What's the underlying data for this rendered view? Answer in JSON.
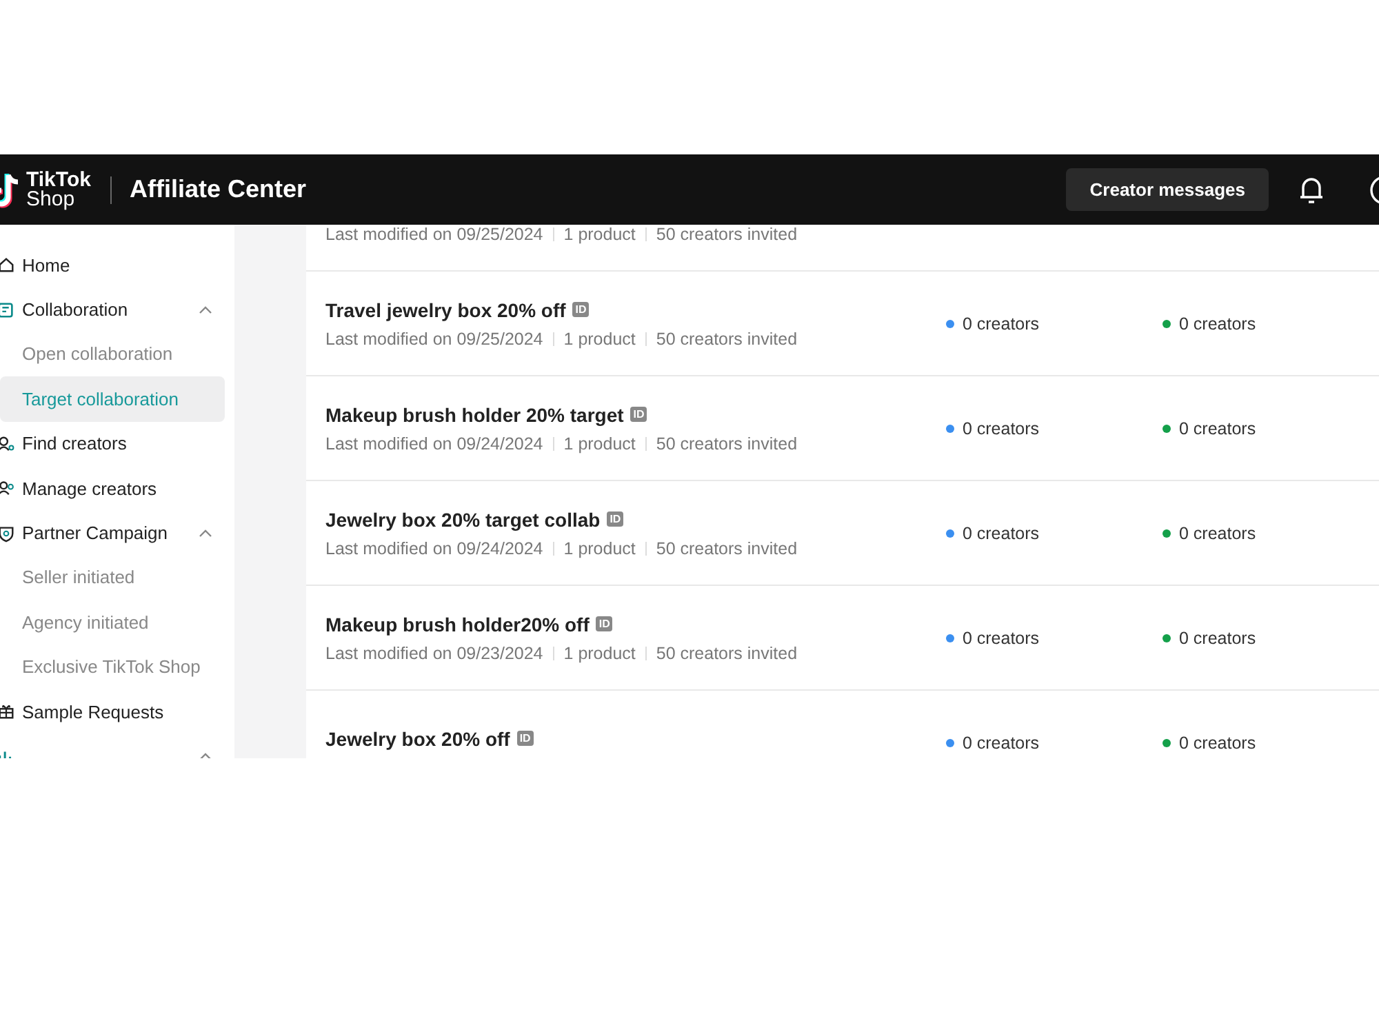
{
  "header": {
    "logo_line_1": "TikTok",
    "logo_line_2": "Shop",
    "title": "Affiliate Center",
    "button": "Creator messages"
  },
  "sidebar": {
    "items": [
      {
        "label": "Home",
        "selected": false
      },
      {
        "label": "Collaboration",
        "selected": false,
        "expanded": true,
        "children": [
          {
            "label": "Open collaboration",
            "selected": false
          },
          {
            "label": "Target collaboration",
            "selected": true
          }
        ]
      },
      {
        "label": "Find creators",
        "selected": false
      },
      {
        "label": "Manage creators",
        "selected": false
      },
      {
        "label": "Partner Campaign",
        "selected": false,
        "expanded": true,
        "children": [
          {
            "label": "Seller initiated",
            "selected": false
          },
          {
            "label": "Agency initiated",
            "selected": false
          },
          {
            "label": "Exclusive TikTok Shop",
            "selected": false
          }
        ]
      },
      {
        "label": "Sample Requests",
        "selected": false
      },
      {
        "selected": false,
        "expanded": true
      }
    ]
  },
  "rows": [
    {
      "meta": [
        "Last modified on 09/25/2024",
        "1 product",
        "50 creators invited"
      ]
    },
    {
      "title": "Travel jewelry box 20% off",
      "badge": "ID",
      "meta": [
        "Last modified on 09/25/2024",
        "1 product",
        "50 creators invited"
      ],
      "status": [
        {
          "text": "0 creators",
          "color": "#3b8ff0"
        },
        {
          "text": "0 creators",
          "color": "#14a04a"
        }
      ]
    },
    {
      "title": "Makeup brush holder 20% target",
      "badge": "ID",
      "meta": [
        "Last modified on 09/24/2024",
        "1 product",
        "50 creators invited"
      ],
      "status": [
        {
          "text": "0 creators",
          "color": "#3b8ff0"
        },
        {
          "text": "0 creators",
          "color": "#14a04a"
        }
      ]
    },
    {
      "title": "Jewelry box 20% target collab",
      "badge": "ID",
      "meta": [
        "Last modified on 09/24/2024",
        "1 product",
        "50 creators invited"
      ],
      "status": [
        {
          "text": "0 creators",
          "color": "#3b8ff0"
        },
        {
          "text": "0 creators",
          "color": "#14a04a"
        }
      ]
    },
    {
      "title": "Makeup brush holder20% off",
      "badge": "ID",
      "meta": [
        "Last modified on 09/23/2024",
        "1 product",
        "50 creators invited"
      ],
      "status": [
        {
          "text": "0 creators",
          "color": "#3b8ff0"
        },
        {
          "text": "0 creators",
          "color": "#14a04a"
        }
      ]
    },
    {
      "title": "Jewelry box 20% off",
      "badge": "ID",
      "status": [
        {
          "text": "0 creators",
          "color": "#3b8ff0"
        },
        {
          "text": "0 creators",
          "color": "#14a04a"
        }
      ]
    }
  ]
}
